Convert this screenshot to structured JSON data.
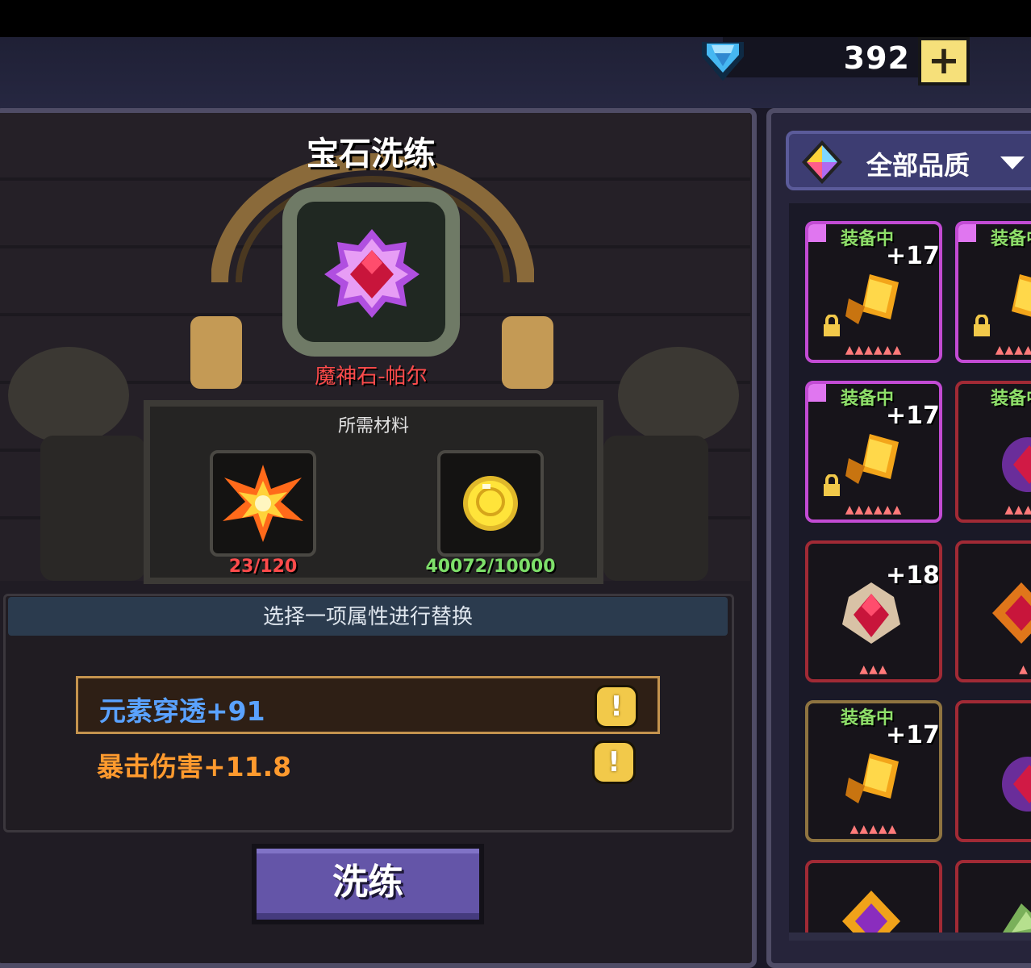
{
  "currency": {
    "gems": "392",
    "add_label": "+"
  },
  "panel": {
    "title": "宝石洗练",
    "gem_name": "魔神石-帕尔",
    "materials_title": "所需材料",
    "materials": [
      {
        "name": "fire-essence",
        "count": "23/120",
        "color": "#ff4b4b"
      },
      {
        "name": "gold-coin",
        "count": "40072/10000",
        "color": "#7ee06a"
      }
    ],
    "attr_header": "选择一项属性进行替换",
    "attributes": [
      {
        "label": "元素穿透+91",
        "color": "#5aa2ff",
        "selected": true
      },
      {
        "label": "暴击伤害+11.8",
        "color": "#ff9a2e",
        "selected": false
      }
    ],
    "reroll_label": "洗练"
  },
  "filter": {
    "label": "全部品质"
  },
  "inventory": {
    "equipped_label": "装备中",
    "cells": [
      {
        "equipped": true,
        "level": "+17",
        "rarity": "purple",
        "icon": "gold-scroll",
        "locked": true
      },
      {
        "equipped": true,
        "level": "",
        "rarity": "purple",
        "icon": "gold-scroll",
        "locked": true
      },
      {
        "equipped": true,
        "level": "+17",
        "rarity": "purple",
        "icon": "gold-scroll",
        "locked": true
      },
      {
        "equipped": true,
        "level": "",
        "rarity": "red",
        "icon": "purple-gem",
        "locked": false
      },
      {
        "equipped": false,
        "level": "+18",
        "rarity": "red",
        "icon": "red-gem",
        "locked": false
      },
      {
        "equipped": false,
        "level": "",
        "rarity": "red",
        "icon": "fire-gem",
        "locked": false
      },
      {
        "equipped": true,
        "level": "+17",
        "rarity": "gold",
        "icon": "gold-scroll",
        "locked": false
      },
      {
        "equipped": false,
        "level": "",
        "rarity": "red",
        "icon": "purple-gem",
        "locked": false
      }
    ]
  },
  "colors": {
    "accent": "#6455a8",
    "panel_border": "#4f4c66",
    "gold": "#f2c94a"
  }
}
